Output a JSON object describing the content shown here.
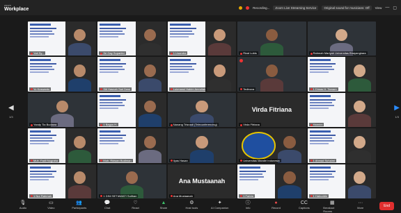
{
  "app": {
    "brand_small": "zoom",
    "brand_big": "Workplace"
  },
  "topbar": {
    "recording": "Recording...",
    "status_text": "Zoom Live Streaming Service",
    "original_sound": "Original sound for musicians: Off",
    "view": "View"
  },
  "tiles": [
    {
      "kind": "slide",
      "name": "Yati Sy..."
    },
    {
      "kind": "slide",
      "name": "Sri Gay Supartini"
    },
    {
      "kind": "slide",
      "name": "1 Lisandra"
    },
    {
      "kind": "plain",
      "name": "Rizal Lubis"
    },
    {
      "kind": "plain",
      "name": "Rahmah Mariyah Universitas Bhayangkara"
    },
    {
      "kind": "slide",
      "name": "Yo Kuswanto"
    },
    {
      "kind": "slide",
      "name": "Siti Hasnah Sari Dewi"
    },
    {
      "kind": "slide",
      "name": "Lukmanul Hakim Amrullah"
    },
    {
      "kind": "plain",
      "name": "Tedinova"
    },
    {
      "kind": "slide",
      "name": "1 Dimas H. Tamam"
    },
    {
      "kind": "plain",
      "name": "Yandy Tia Budiana"
    },
    {
      "kind": "slide",
      "name": "1 Bagus H."
    },
    {
      "kind": "plain",
      "name": "Nanang Trisnadi (Teleconferencing)"
    },
    {
      "kind": "bigname",
      "name": "Virda Fitriana",
      "label": "Virda Fitriana"
    },
    {
      "kind": "slide",
      "name": "Harmini"
    },
    {
      "kind": "slide",
      "name": "Muh. Fadli Nugraha"
    },
    {
      "kind": "slide",
      "name": "Muh. Ridwan Budiman"
    },
    {
      "kind": "plain",
      "name": "Ilyas Hasan"
    },
    {
      "kind": "logo",
      "name": "Universitas Mandiri Indonesia"
    },
    {
      "kind": "slide",
      "name": "1 Ahmad Suhaimi"
    },
    {
      "kind": "slide",
      "name": "1 Nur Rahmah"
    },
    {
      "kind": "plain",
      "name": "1 DINI SETIAWATI Sulthan"
    },
    {
      "kind": "bigname",
      "name": "Ana Mustaanah",
      "label": "Ana Mustaanah"
    },
    {
      "kind": "slide",
      "name": "1 Farida"
    },
    {
      "kind": "slide",
      "name": "1 Hairuddin"
    }
  ],
  "nav": {
    "prev_label": "1/3",
    "next_label": "1/3"
  },
  "toolbar": [
    {
      "icon": "microphone-icon",
      "glyph": "🎙",
      "label": "Audio"
    },
    {
      "icon": "video-icon",
      "glyph": "▭",
      "label": "Video"
    },
    {
      "icon": "participants-icon",
      "glyph": "👥",
      "label": "Participants"
    },
    {
      "icon": "chat-icon",
      "glyph": "💬",
      "label": "Chat"
    },
    {
      "icon": "react-icon",
      "glyph": "♡",
      "label": "React"
    },
    {
      "icon": "share-icon",
      "glyph": "▲",
      "label": "Share"
    },
    {
      "icon": "host-tools-icon",
      "glyph": "⚙",
      "label": "Host tools"
    },
    {
      "icon": "ai-companion-icon",
      "glyph": "✦",
      "label": "AI Companion"
    },
    {
      "icon": "info-icon",
      "glyph": "ⓘ",
      "label": "Info"
    },
    {
      "icon": "record-icon",
      "glyph": "●",
      "label": "Record"
    },
    {
      "icon": "captions-icon",
      "glyph": "CC",
      "label": "Captions"
    },
    {
      "icon": "breakout-icon",
      "glyph": "▦",
      "label": "Breakout Rooms"
    },
    {
      "icon": "more-icon",
      "glyph": "···",
      "label": "More"
    }
  ],
  "end_button": "End"
}
